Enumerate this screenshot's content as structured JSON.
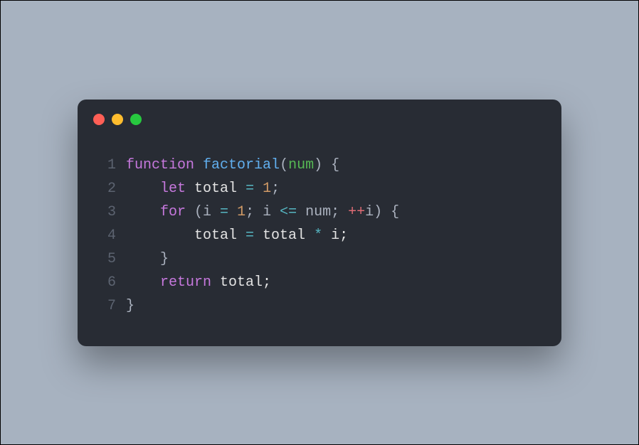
{
  "window": {
    "dots": {
      "red": "#ff5f56",
      "yellow": "#ffbd2e",
      "green": "#27c93f"
    }
  },
  "code": {
    "lines": [
      {
        "num": "1",
        "segs": [
          {
            "t": "function",
            "c": "kw-func"
          },
          {
            "t": " ",
            "c": "plain"
          },
          {
            "t": "factorial",
            "c": "funcname"
          },
          {
            "t": "(",
            "c": "punc"
          },
          {
            "t": "num",
            "c": "param"
          },
          {
            "t": ") {",
            "c": "punc"
          }
        ]
      },
      {
        "num": "2",
        "segs": [
          {
            "t": "    ",
            "c": "plain"
          },
          {
            "t": "let",
            "c": "kw-let"
          },
          {
            "t": " ",
            "c": "plain"
          },
          {
            "t": "total",
            "c": "plain"
          },
          {
            "t": " ",
            "c": "plain"
          },
          {
            "t": "=",
            "c": "op"
          },
          {
            "t": " ",
            "c": "plain"
          },
          {
            "t": "1",
            "c": "num"
          },
          {
            "t": ";",
            "c": "punc"
          }
        ]
      },
      {
        "num": "3",
        "segs": [
          {
            "t": "    ",
            "c": "plain"
          },
          {
            "t": "for",
            "c": "kw-for"
          },
          {
            "t": " (i ",
            "c": "punc"
          },
          {
            "t": "=",
            "c": "op"
          },
          {
            "t": " ",
            "c": "plain"
          },
          {
            "t": "1",
            "c": "num"
          },
          {
            "t": "; i ",
            "c": "punc"
          },
          {
            "t": "<=",
            "c": "op"
          },
          {
            "t": " num; ",
            "c": "punc"
          },
          {
            "t": "++",
            "c": "inc"
          },
          {
            "t": "i) {",
            "c": "punc"
          }
        ]
      },
      {
        "num": "4",
        "segs": [
          {
            "t": "        total ",
            "c": "plain"
          },
          {
            "t": "=",
            "c": "op"
          },
          {
            "t": " total ",
            "c": "plain"
          },
          {
            "t": "*",
            "c": "op"
          },
          {
            "t": " i;",
            "c": "plain"
          }
        ]
      },
      {
        "num": "5",
        "segs": [
          {
            "t": "    }",
            "c": "punc"
          }
        ]
      },
      {
        "num": "6",
        "segs": [
          {
            "t": "    ",
            "c": "plain"
          },
          {
            "t": "return",
            "c": "kw-return"
          },
          {
            "t": " total;",
            "c": "plain"
          }
        ]
      },
      {
        "num": "7",
        "segs": [
          {
            "t": "}",
            "c": "punc"
          }
        ]
      }
    ]
  }
}
